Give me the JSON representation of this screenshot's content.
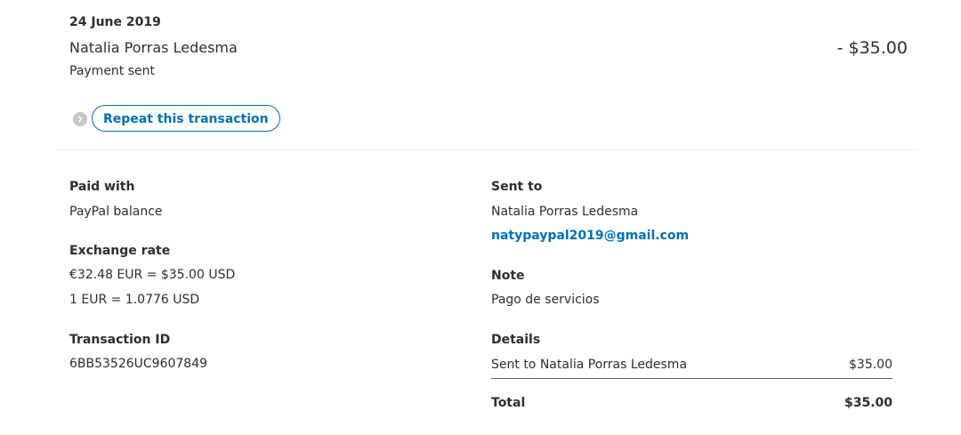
{
  "header": {
    "date": "24 June 2019",
    "counterparty": "Natalia Porras Ledesma",
    "status": "Payment sent",
    "amount": "- $35.00",
    "repeat_label": "Repeat this transaction"
  },
  "left": {
    "paid_with_label": "Paid with",
    "paid_with_value": "PayPal balance",
    "exchange_label": "Exchange rate",
    "exchange_line1": "€32.48 EUR = $35.00 USD",
    "exchange_line2": "1 EUR = 1.0776 USD",
    "txn_label": "Transaction ID",
    "txn_value": "6BB53526UC9607849"
  },
  "right": {
    "sent_to_label": "Sent to",
    "sent_to_name": "Natalia Porras Ledesma",
    "sent_to_email": "natypaypal2019@gmail.com",
    "note_label": "Note",
    "note_value": "Pago de servicios",
    "details_label": "Details",
    "details_row_label": "Sent to Natalia Porras Ledesma",
    "details_row_amount": "$35.00",
    "total_label": "Total",
    "total_amount": "$35.00"
  },
  "colors": {
    "accent": "#0070ba",
    "text": "#2c2e2f"
  }
}
